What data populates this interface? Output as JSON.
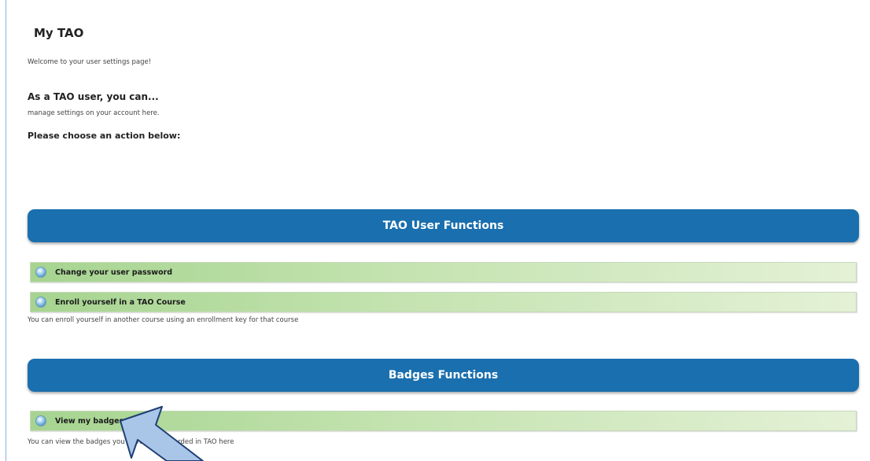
{
  "page": {
    "title": "My TAO",
    "welcome": "Welcome to your user settings page!",
    "subheading": "As a TAO user, you can...",
    "subtext": "manage settings on your account here.",
    "choose": "Please choose an action below:"
  },
  "sections": [
    {
      "title": "TAO User Functions",
      "actions": [
        {
          "label": "Change your user password",
          "icon": "globe-icon",
          "description": ""
        },
        {
          "label": "Enroll yourself in a TAO Course",
          "icon": "globe-icon",
          "description": "You can enroll yourself in another course using an enrollment key for that course"
        }
      ]
    },
    {
      "title": "Badges Functions",
      "actions": [
        {
          "label": "View my badges",
          "icon": "globe-icon",
          "description": "You can view the badges you have been awarded in TAO here"
        }
      ]
    }
  ],
  "annotation": {
    "icon": "callout-arrow-icon",
    "color": "#a9c6e8",
    "stroke": "#1f3f75"
  },
  "colors": {
    "section_bar": "#1a6fae",
    "row_gradient_start": "#a6d490",
    "row_gradient_end": "#e4f1d6"
  }
}
